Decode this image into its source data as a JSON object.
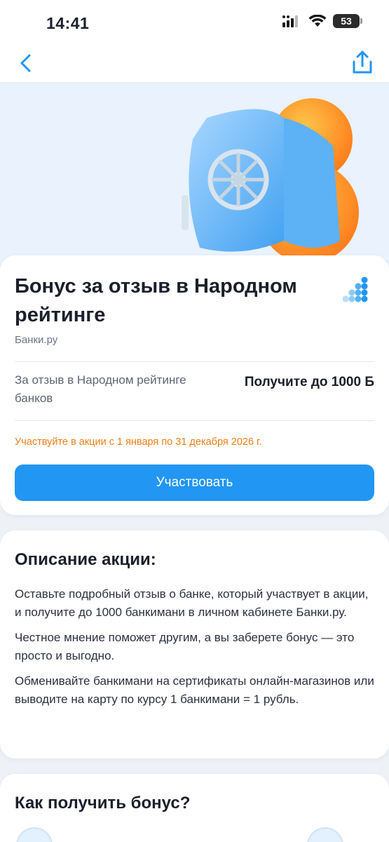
{
  "status_bar": {
    "time": "14:41",
    "battery": "53",
    "icons": [
      "signal-icon",
      "wifi-icon",
      "battery-icon"
    ]
  },
  "nav": {
    "back_icon": "chevron-left-icon",
    "share_icon": "share-icon"
  },
  "promo": {
    "title": "Бонус за отзыв в Народном рейтинге",
    "source": "Банки.ру",
    "reward_label": "За отзыв в Народном рейтинге банков",
    "reward_value": "Получите до 1000 Б",
    "period": "Участвуйте в акции с 1 января по 31 декабря 2026 г.",
    "cta_label": "Участвовать"
  },
  "description": {
    "title": "Описание акции:",
    "paragraphs": [
      "Оставьте подробный отзыв о банке, который участвует в акции, и получите до 1000 банкимани в личном кабинете Банки.ру.",
      "Честное мнение поможет другим, а вы заберете бонус — это просто и выгодно.",
      "Обменивайте банкимани на сертификаты онлайн-магазинов или выводите на карту по курсу 1 банкимани = 1 рубль."
    ]
  },
  "how": {
    "title": "Как получить бонус?"
  },
  "colors": {
    "accent": "#2196f3",
    "period": "#ef7d16",
    "hero_bg": "#e9f2fd"
  }
}
